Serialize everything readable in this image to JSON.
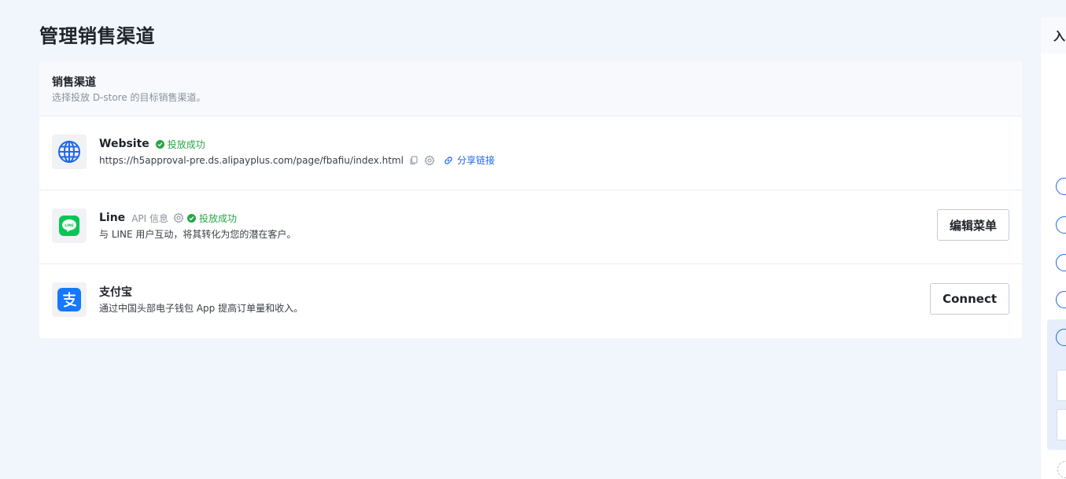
{
  "page": {
    "title": "管理销售渠道"
  },
  "card": {
    "title": "销售渠道",
    "subtitle": "选择投放 D-store 的目标销售渠道。"
  },
  "channels": [
    {
      "name": "Website",
      "icon": "globe-icon",
      "status": "投放成功",
      "url": "https://h5approval-pre.ds.alipayplus.com/page/fbafiu/index.html",
      "share_label": "分享链接"
    },
    {
      "name": "Line",
      "icon": "line-logo",
      "api_label": "API 信息",
      "status": "投放成功",
      "description": "与 LINE 用户互动，将其转化为您的潜在客户。",
      "button_label": "编辑菜单"
    },
    {
      "name": "支付宝",
      "icon": "alipay-logo",
      "description": "通过中国头部电子钱包 App 提高订单量和收入。",
      "button_label": "Connect"
    }
  ],
  "side_panel": {
    "title": "入"
  },
  "colors": {
    "background": "#f1f5fc",
    "success": "#27a644",
    "link": "#1f66e5",
    "line_green": "#06c755",
    "alipay_blue": "#1677ff"
  }
}
